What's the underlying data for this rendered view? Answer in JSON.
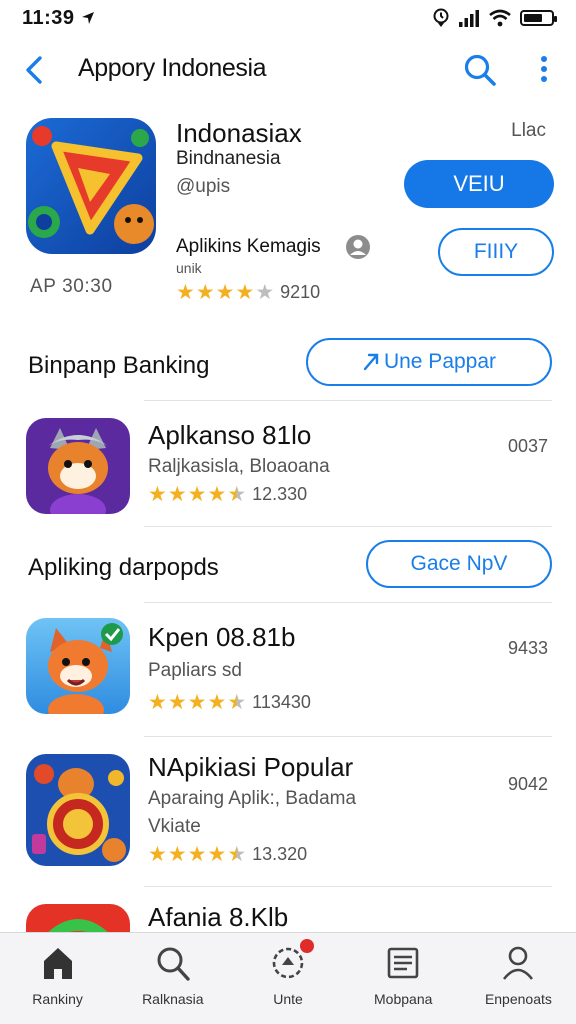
{
  "status": {
    "time": "11:39"
  },
  "nav": {
    "title": "Appory Indonesia"
  },
  "hero": {
    "app_title": "Indonasiax",
    "subtitle": "Bindnanesia",
    "developer": "@upis",
    "tag": "Llac",
    "primary_button": "VEIU",
    "secondary_button": "FIIIY",
    "info_name": "Aplikins Kemagis",
    "info_category": "unik",
    "age": "AP  30:30",
    "rating_stars": 4,
    "rating_count": "9210"
  },
  "sections": [
    {
      "label": "Binpanp Banking",
      "button": "Une Pappar",
      "button_icon": "arrow-icon"
    },
    {
      "label": "Apliking  darpopds",
      "button": "Gace NpV"
    }
  ],
  "apps": [
    {
      "name": "Aplkanso 81lo",
      "subtitle": "Raljkasisla, Bloaoana",
      "subtitle2": "",
      "rating_stars": 4.5,
      "rating_count": "12.330",
      "rank": "0037"
    },
    {
      "name": "Kpen 08.81b",
      "subtitle": "Papliars sd",
      "subtitle2": "",
      "rating_stars": 4.5,
      "rating_count": "113430",
      "rank": "9433"
    },
    {
      "name": "NApikiasi Popular",
      "subtitle": "Aparaing Aplik:, Badama",
      "subtitle2": "Vkiate",
      "rating_stars": 4.5,
      "rating_count": "13.320",
      "rank": "9042"
    },
    {
      "name": "Afania 8.Klb",
      "subtitle": "",
      "subtitle2": "",
      "rating_stars": 0,
      "rating_count": "",
      "rank": ""
    }
  ],
  "tabs": [
    {
      "label": "Rankiny",
      "icon": "home-icon"
    },
    {
      "label": "Ralknasia",
      "icon": "search-icon"
    },
    {
      "label": "Unte",
      "icon": "updates-icon",
      "badge": true
    },
    {
      "label": "Mobpana",
      "icon": "list-icon"
    },
    {
      "label": "Enpenoats",
      "icon": "profile-icon"
    }
  ],
  "colors": {
    "accent": "#1677e6",
    "star": "#f3b121",
    "badge": "#e02b2b"
  }
}
